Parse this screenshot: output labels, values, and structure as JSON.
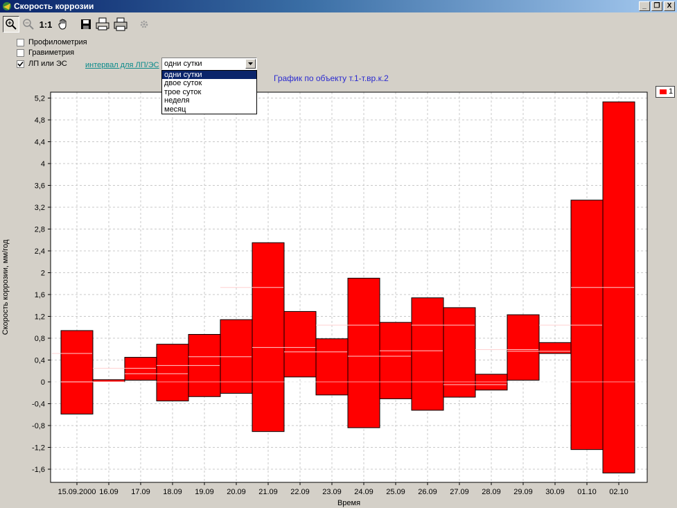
{
  "window": {
    "title": "Скорость коррозии",
    "controls": [
      "_",
      "❐",
      "X"
    ]
  },
  "toolbar": {
    "one_to_one": "1:1"
  },
  "options": {
    "checkboxes": [
      {
        "label": "Профилометрия",
        "checked": false
      },
      {
        "label": "Гравиметрия",
        "checked": false
      },
      {
        "label": "ЛП или ЭС",
        "checked": true
      }
    ],
    "interval_label": "интервал для ЛП/ЭС",
    "interval_value": "одни сутки",
    "interval_options": [
      "одни сутки",
      "двое суток",
      "трое суток",
      "неделя",
      "месяц"
    ]
  },
  "legend": {
    "label": "1",
    "color": "#ff0000"
  },
  "chart_data": {
    "type": "bar",
    "subtype": "floating-range",
    "title": "График по объекту т.1-т.вр.к.2",
    "xlabel": "Время",
    "ylabel": "Скорость коррозии, мм/год",
    "ylim": [
      -1.8,
      5.3
    ],
    "yticks": [
      "5,2",
      "4,8",
      "4,4",
      "4",
      "3,6",
      "3,2",
      "2,8",
      "2,4",
      "2",
      "1,6",
      "1,2",
      "0,8",
      "0,4",
      "0",
      "-0,4",
      "-0,8",
      "-1,2",
      "-1,6"
    ],
    "ytick_values": [
      5.2,
      4.8,
      4.4,
      4,
      3.6,
      3.2,
      2.8,
      2.4,
      2,
      1.6,
      1.2,
      0.8,
      0.4,
      0,
      -0.4,
      -0.8,
      -1.2,
      -1.6
    ],
    "categories": [
      "15.09.2000",
      "16.09",
      "17.09",
      "18.09",
      "19.09",
      "20.09",
      "21.09",
      "22.09",
      "23.09",
      "24.09",
      "25.09",
      "26.09",
      "27.09",
      "28.09",
      "29.09",
      "30.09",
      "01.10",
      "02.10"
    ],
    "series": [
      {
        "name": "1",
        "color": "#ff0000",
        "low": [
          -0.59,
          0.0,
          0.03,
          -0.35,
          -0.27,
          -0.21,
          -0.91,
          0.09,
          -0.24,
          -0.84,
          -0.31,
          -0.52,
          -0.28,
          -0.15,
          0.03,
          0.52,
          -1.24,
          -1.67
        ],
        "high": [
          0.94,
          0.04,
          0.45,
          0.69,
          0.87,
          1.14,
          2.55,
          1.29,
          0.79,
          1.9,
          1.09,
          1.54,
          1.36,
          0.14,
          1.23,
          0.72,
          3.33,
          5.13
        ],
        "median": [
          0.52,
          0.0,
          0.25,
          0.15,
          0.3,
          0.46,
          1.73,
          0.63,
          0.55,
          1.04,
          0.47,
          0.57,
          1.04,
          -0.05,
          0.59,
          0.56,
          1.04,
          1.73
        ]
      }
    ],
    "grid": true,
    "legend_position": "top-right"
  }
}
